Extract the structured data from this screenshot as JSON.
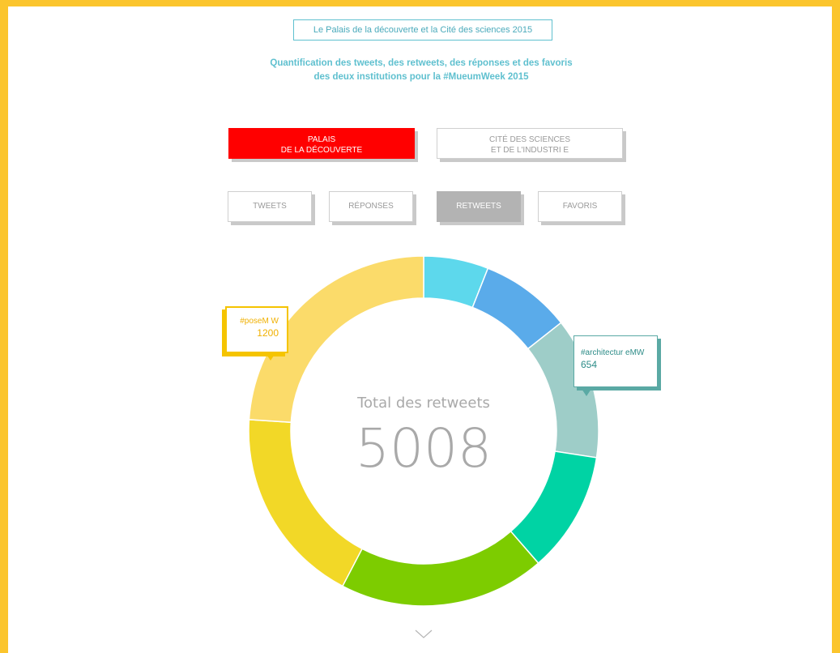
{
  "header": {
    "title": "Le Palais de la découverte et la Cité des sciences 2015",
    "subtitle_line1": "Quantification des tweets, des retweets, des réponses et des favoris",
    "subtitle_line2": "des deux institutions pour la #MueumWeek 2015"
  },
  "institution_tabs": [
    {
      "line1": "PALAIS",
      "line2": "DE LA DÉCOUVERTE",
      "active": true
    },
    {
      "line1": "CITÉ DES SCIENCES",
      "line2": "ET DE L'INDUSTRI E",
      "active": false
    }
  ],
  "metric_tabs": [
    {
      "label": "TWEETS",
      "active": false
    },
    {
      "label": "RÉPONSES",
      "active": false
    },
    {
      "label": "RETWEETS",
      "active": true
    },
    {
      "label": "FAVORIS",
      "active": false
    }
  ],
  "center": {
    "caption": "Total des retweets",
    "total": "5008"
  },
  "callouts": {
    "pose": {
      "name": "#poseM W",
      "value": "1200"
    },
    "archi": {
      "name": "#architectur eMW",
      "value": "654"
    }
  },
  "colors": {
    "frame": "#fbc52d",
    "active_institution": "#ff0000",
    "active_metric": "#b3b3b3"
  },
  "icons": {
    "scroll": "chevron-down-icon"
  },
  "chart_data": {
    "type": "pie",
    "variant": "donut",
    "slices": [
      {
        "value": 300,
        "color": "#5dd8ec"
      },
      {
        "value": 420,
        "color": "#5aabea"
      },
      {
        "value": 654,
        "color": "#9ecdc8"
      },
      {
        "value": 560,
        "color": "#00d3a4"
      },
      {
        "value": 954,
        "color": "#7dcc00"
      },
      {
        "value": 920,
        "color": "#f2d827"
      },
      {
        "value": 1200,
        "color": "#fbdb6a"
      }
    ],
    "total": 5008
  }
}
